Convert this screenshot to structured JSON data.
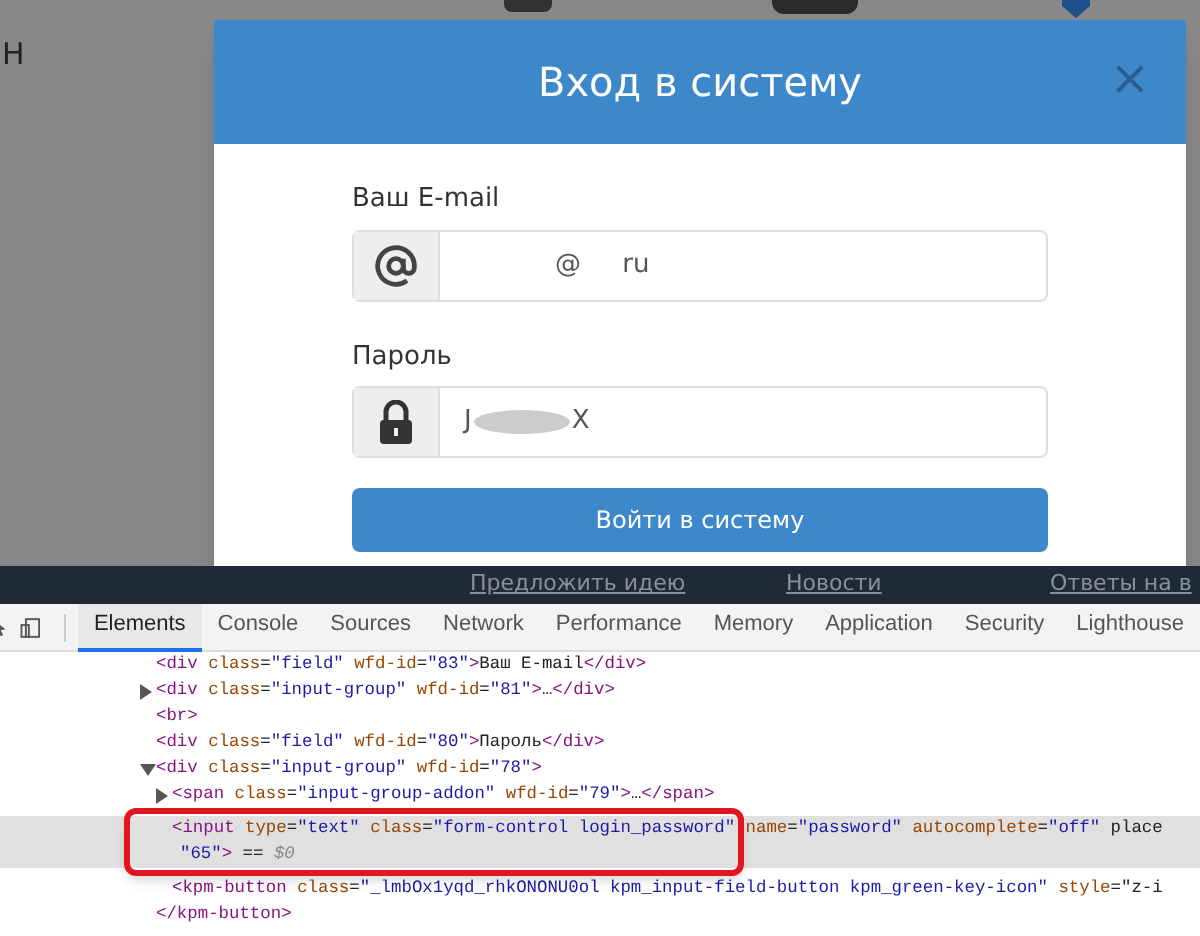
{
  "background_text": "Н",
  "modal": {
    "title": "Вход в систему",
    "close": "×",
    "fields": [
      {
        "label": "Ваш E-mail",
        "kind": "email",
        "value": "           @     ru"
      },
      {
        "label": "Пароль",
        "kind": "password",
        "value_start": "J",
        "value_end": "X"
      }
    ],
    "submit": "Войти в систему"
  },
  "footer_links": [
    "Предложить идею",
    "Новости",
    "Ответы на в"
  ],
  "devtools": {
    "tabs": [
      {
        "label": "Elements",
        "selected": true
      },
      {
        "label": "Console",
        "selected": false
      },
      {
        "label": "Sources",
        "selected": false
      },
      {
        "label": "Network",
        "selected": false
      },
      {
        "label": "Performance",
        "selected": false
      },
      {
        "label": "Memory",
        "selected": false
      },
      {
        "label": "Application",
        "selected": false
      },
      {
        "label": "Security",
        "selected": false
      },
      {
        "label": "Lighthouse",
        "selected": false
      }
    ],
    "nodes": [
      {
        "text": "<div class=\"field\" wfd-id=\"83\">Ваш E-mail</div>",
        "selected": false
      },
      {
        "text": "<div class=\"input-group\" wfd-id=\"81\">…</div>",
        "expanded": false,
        "selected": false
      },
      {
        "text": "<br>",
        "selected": false
      },
      {
        "text": "<div class=\"field\" wfd-id=\"80\">Пароль</div>",
        "selected": false
      },
      {
        "text": "<div class=\"input-group\" wfd-id=\"78\">",
        "expanded": true,
        "selected": false,
        "children": [
          {
            "text": "<span class=\"input-group-addon\" wfd-id=\"79\">…</span>",
            "expanded": false,
            "selected": false
          },
          {
            "text": "<input type=\"text\" class=\"form-control login_password\" name=\"password\" autocomplete=\"off\" place",
            "continuation": "\"65\"> == $0",
            "selected": true
          },
          {
            "text": "<kpm-button class=\"_lmbOx1yqd_rhkONONU0ol kpm_input-field-button kpm_green-key-icon\" style=\"z-i",
            "selected": false
          }
        ]
      },
      {
        "text": "</kpm-button>",
        "selected": false
      }
    ]
  }
}
